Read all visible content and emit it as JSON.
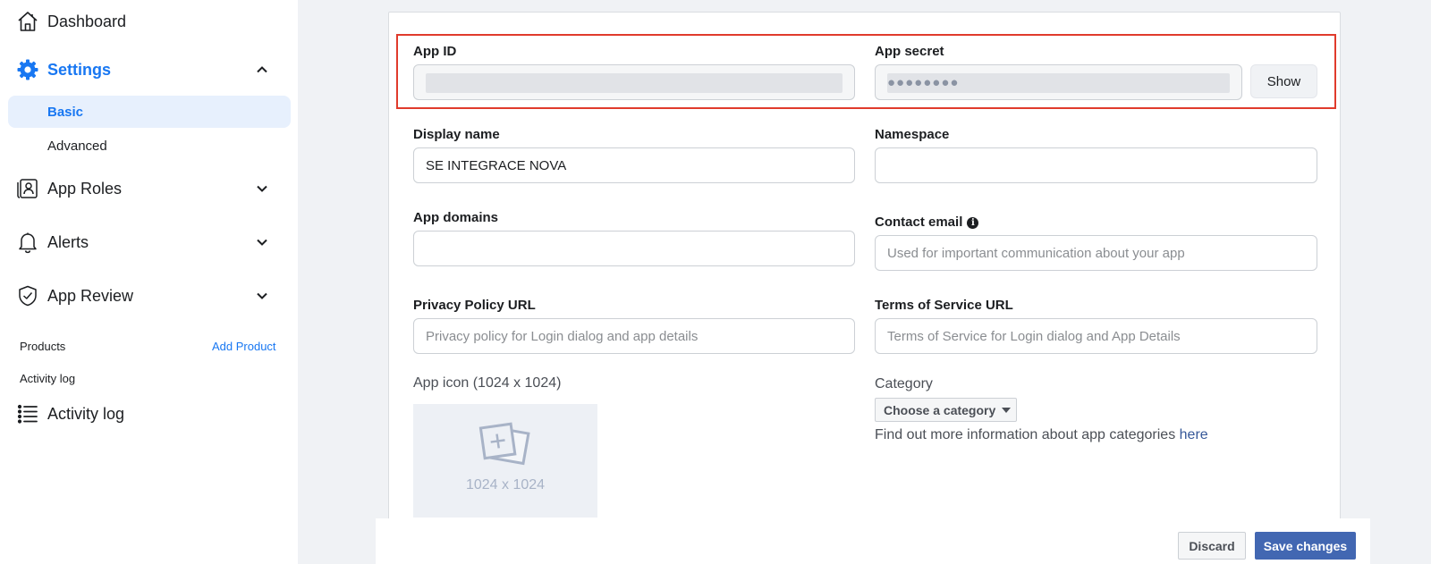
{
  "sidebar": {
    "dashboard": {
      "label": "Dashboard",
      "icon": "home-icon"
    },
    "settings": {
      "label": "Settings",
      "icon": "gear-icon"
    },
    "basic": {
      "label": "Basic"
    },
    "advanced": {
      "label": "Advanced"
    },
    "app_roles": {
      "label": "App Roles",
      "icon": "id-badge-icon"
    },
    "alerts": {
      "label": "Alerts",
      "icon": "bell-icon"
    },
    "app_review": {
      "label": "App Review",
      "icon": "shield-check-icon"
    },
    "products_label": "Products",
    "add_product": "Add Product",
    "activity_log_section": "Activity log",
    "activity_log": {
      "label": "Activity log",
      "icon": "list-icon"
    }
  },
  "form": {
    "app_id": {
      "label": "App ID",
      "value": ""
    },
    "app_secret": {
      "label": "App secret",
      "value": "●●●●●●●●",
      "show_label": "Show"
    },
    "display_name": {
      "label": "Display name",
      "value": "SE INTEGRACE NOVA"
    },
    "namespace": {
      "label": "Namespace",
      "value": ""
    },
    "app_domains": {
      "label": "App domains",
      "value": ""
    },
    "contact_email": {
      "label": "Contact email",
      "placeholder": "Used for important communication about your app"
    },
    "privacy_policy": {
      "label": "Privacy Policy URL",
      "placeholder": "Privacy policy for Login dialog and app details"
    },
    "terms_of_service": {
      "label": "Terms of Service URL",
      "placeholder": "Terms of Service for Login dialog and App Details"
    },
    "app_icon": {
      "label": "App icon (1024 x 1024)",
      "size_text": "1024 x 1024"
    },
    "category": {
      "label": "Category",
      "button": "Choose a category",
      "info": "Find out more information about app categories ",
      "info_link": "here"
    }
  },
  "footer": {
    "discard": "Discard",
    "save": "Save changes"
  },
  "colors": {
    "accent": "#1877f2",
    "highlight": "#e03b2c",
    "save": "#4267b2"
  }
}
